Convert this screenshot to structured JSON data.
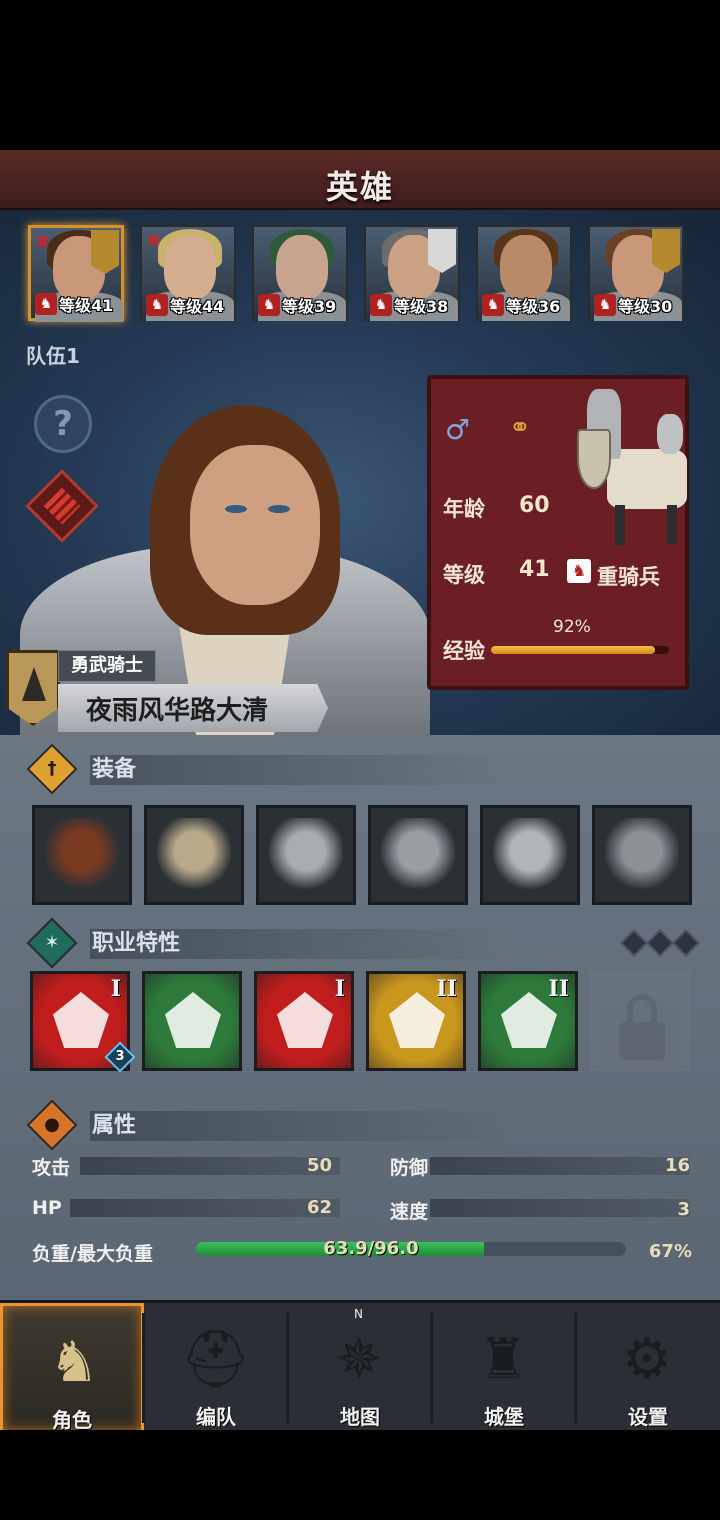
{
  "header": {
    "title": "英雄"
  },
  "heroes": [
    {
      "level_text": "等级41",
      "hair": "#4a2c18",
      "face": "#c99779",
      "banner": "gold",
      "ribbon": true,
      "selected": true
    },
    {
      "level_text": "等级44",
      "hair": "#c9b36a",
      "face": "#d5ad8f",
      "banner": "none",
      "ribbon": true,
      "selected": false
    },
    {
      "level_text": "等级39",
      "hair": "#2f5a3a",
      "face": "#c9a58f",
      "banner": "none",
      "ribbon": false,
      "selected": false
    },
    {
      "level_text": "等级38",
      "hair": "#6c6c6c",
      "face": "#caa184",
      "banner": "white",
      "ribbon": false,
      "selected": false
    },
    {
      "level_text": "等级36",
      "hair": "#5a3418",
      "face": "#b98a6a",
      "banner": "none",
      "ribbon": false,
      "selected": false
    },
    {
      "level_text": "等级30",
      "hair": "#6a4024",
      "face": "#c9987a",
      "banner": "gold",
      "ribbon": false,
      "selected": false
    }
  ],
  "team_label": "队伍1",
  "info": {
    "gender_icon": "♂",
    "ring_icon": "ring-icon",
    "age_label": "年龄",
    "age_value": "60",
    "level_label": "等级",
    "level_value": "41",
    "class_name": "重骑兵",
    "exp_label": "经验",
    "exp_percent_text": "92%",
    "exp_fraction": 0.92
  },
  "hero": {
    "title": "勇武骑士",
    "name": "夜雨风华路大清"
  },
  "equipment": {
    "title": "装备",
    "slots": [
      {
        "name": "spear-item",
        "color": "#7a3a22"
      },
      {
        "name": "shield-item",
        "color": "#b8a98a"
      },
      {
        "name": "helmet-item",
        "color": "#a9adb1"
      },
      {
        "name": "armor-item",
        "color": "#9a9ea3"
      },
      {
        "name": "boots-item",
        "color": "#b1b4b8"
      },
      {
        "name": "ring-item",
        "color": "#8d9196"
      }
    ]
  },
  "traits": {
    "title": "职业特性",
    "items": [
      {
        "name": "sword-arrow-trait",
        "bg": "#c21d1d",
        "roman": "I",
        "badge": "3"
      },
      {
        "name": "horse-charge-trait",
        "bg": "#2e7a3a",
        "roman": "",
        "badge": ""
      },
      {
        "name": "strength-horse-trait",
        "bg": "#c21d1d",
        "roman": "I",
        "badge": ""
      },
      {
        "name": "shield-trait",
        "bg": "#c9961e",
        "roman": "II",
        "badge": ""
      },
      {
        "name": "target-trait",
        "bg": "#2e7a3a",
        "roman": "II",
        "badge": ""
      }
    ]
  },
  "attributes": {
    "title": "属性",
    "attack_label": "攻击",
    "attack_value": "50",
    "defense_label": "防御",
    "defense_value": "16",
    "hp_label": "HP",
    "hp_value": "62",
    "speed_label": "速度",
    "speed_value": "3",
    "load_label": "负重/最大负重",
    "load_text": "63.9/96.0",
    "load_percent_text": "67%",
    "load_fraction": 0.67
  },
  "tabs": [
    {
      "label": "角色",
      "icon": "knight-icon",
      "glyph": "♞",
      "active": true
    },
    {
      "label": "编队",
      "icon": "helmet-icon",
      "glyph": "⛑",
      "active": false
    },
    {
      "label": "地图",
      "icon": "compass-icon",
      "glyph": "✵",
      "active": false,
      "compass_letter": "N"
    },
    {
      "label": "城堡",
      "icon": "castle-icon",
      "glyph": "♜",
      "active": false
    },
    {
      "label": "设置",
      "icon": "gear-icon",
      "glyph": "⚙",
      "active": false
    }
  ]
}
